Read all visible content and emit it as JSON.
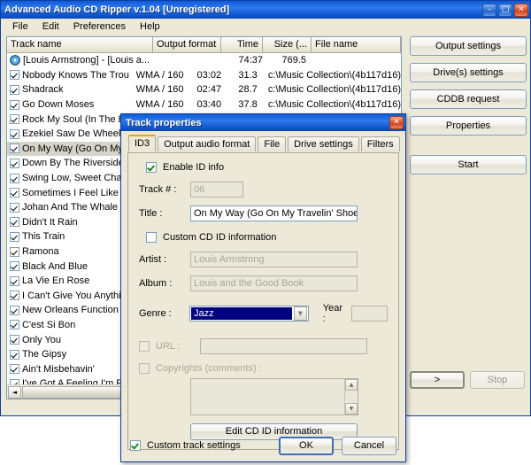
{
  "window": {
    "title": "Advanced Audio CD Ripper v.1.04 [Unregistered]",
    "minimize_label": "–",
    "maximize_label": "□",
    "close_label": "✕"
  },
  "menu": {
    "items": [
      {
        "label": "File"
      },
      {
        "label": "Edit"
      },
      {
        "label": "Preferences"
      },
      {
        "label": "Help"
      }
    ]
  },
  "list": {
    "columns": [
      {
        "label": "Track name"
      },
      {
        "label": "Output format"
      },
      {
        "label": "Time"
      },
      {
        "label": "Size (..."
      },
      {
        "label": "File name"
      }
    ],
    "rows": [
      {
        "icon": "cd-disc-icon",
        "checked": null,
        "name": "[Louis Armstrong] - [Louis a...",
        "format": "",
        "time": "74:37",
        "size": "769.5",
        "file": ""
      },
      {
        "icon": "checkbox",
        "checked": true,
        "name": "Nobody Knows The Trouble ...",
        "format": "WMA / 160",
        "time": "03:02",
        "size": "31.3",
        "file": "c:\\Music Collection\\(4b117d16)"
      },
      {
        "icon": "checkbox",
        "checked": true,
        "name": "Shadrack",
        "format": "WMA / 160",
        "time": "02:47",
        "size": "28.7",
        "file": "c:\\Music Collection\\(4b117d16)"
      },
      {
        "icon": "checkbox",
        "checked": true,
        "name": "Go Down Moses",
        "format": "WMA / 160",
        "time": "03:40",
        "size": "37.8",
        "file": "c:\\Music Collection\\(4b117d16)"
      },
      {
        "icon": "checkbox",
        "checked": true,
        "name": "Rock My Soul (In The Bosom",
        "format": "WMA / 160",
        "time": "02:58",
        "size": "30.6",
        "file": "c:\\Music Collection\\(4b117d16)"
      },
      {
        "icon": "checkbox",
        "checked": true,
        "name": "Ezekiel Saw De Wheel",
        "format": "",
        "time": "",
        "size": "",
        "file": ")"
      },
      {
        "icon": "checkbox",
        "checked": true,
        "name": "On My Way (Go On My Tr",
        "format": "",
        "time": "",
        "size": "",
        "file": ")",
        "selected": true
      },
      {
        "icon": "checkbox",
        "checked": true,
        "name": "Down By The Riverside",
        "format": "",
        "time": "",
        "size": "",
        "file": ")"
      },
      {
        "icon": "checkbox",
        "checked": true,
        "name": "Swing Low, Sweet Chario",
        "format": "",
        "time": "",
        "size": "",
        "file": ")"
      },
      {
        "icon": "checkbox",
        "checked": true,
        "name": "Sometimes I Feel Like A M",
        "format": "",
        "time": "",
        "size": "",
        "file": ")"
      },
      {
        "icon": "checkbox",
        "checked": true,
        "name": "Johan And The Whale",
        "format": "",
        "time": "",
        "size": "",
        "file": ")"
      },
      {
        "icon": "checkbox",
        "checked": true,
        "name": "Didn't It Rain",
        "format": "",
        "time": "",
        "size": "",
        "file": ")"
      },
      {
        "icon": "checkbox",
        "checked": true,
        "name": "This Train",
        "format": "",
        "time": "",
        "size": "",
        "file": ")"
      },
      {
        "icon": "checkbox",
        "checked": true,
        "name": "Ramona",
        "format": "",
        "time": "",
        "size": "",
        "file": ")"
      },
      {
        "icon": "checkbox",
        "checked": true,
        "name": "Black And Blue",
        "format": "",
        "time": "",
        "size": "",
        "file": ")"
      },
      {
        "icon": "checkbox",
        "checked": true,
        "name": "La Vie En Rose",
        "format": "",
        "time": "",
        "size": "",
        "file": ")"
      },
      {
        "icon": "checkbox",
        "checked": true,
        "name": "I Can't Give You Anything",
        "format": "",
        "time": "",
        "size": "",
        "file": ")"
      },
      {
        "icon": "checkbox",
        "checked": true,
        "name": "New Orleans Function",
        "format": "",
        "time": "",
        "size": "",
        "file": ")"
      },
      {
        "icon": "checkbox",
        "checked": true,
        "name": "C'est Si Bon",
        "format": "",
        "time": "",
        "size": "",
        "file": ")"
      },
      {
        "icon": "checkbox",
        "checked": true,
        "name": "Only You",
        "format": "",
        "time": "",
        "size": "",
        "file": ")"
      },
      {
        "icon": "checkbox",
        "checked": true,
        "name": "The Gipsy",
        "format": "",
        "time": "",
        "size": "",
        "file": ")"
      },
      {
        "icon": "checkbox",
        "checked": true,
        "name": "Ain't Misbehavin'",
        "format": "",
        "time": "",
        "size": "",
        "file": ")"
      },
      {
        "icon": "checkbox",
        "checked": true,
        "name": "I've Got A Feeling I'm Fall",
        "format": "",
        "time": "",
        "size": "",
        "file": ")"
      }
    ],
    "scrollbar": {
      "left_arrow": "◄",
      "right_arrow": "►"
    }
  },
  "side_buttons": [
    {
      "label": "Output settings"
    },
    {
      "label": "Drive(s) settings"
    },
    {
      "label": "CDDB request"
    },
    {
      "label": "Properties"
    },
    {
      "label": "Start"
    }
  ],
  "bottom_buttons": {
    "next_label": ">",
    "stop_label": "Stop"
  },
  "dialog": {
    "title": "Track properties",
    "close_label": "✕",
    "tabs": [
      {
        "label": "ID3",
        "active": true
      },
      {
        "label": "Output audio format",
        "active": false
      },
      {
        "label": "File",
        "active": false
      },
      {
        "label": "Drive settings",
        "active": false
      },
      {
        "label": "Filters",
        "active": false
      }
    ],
    "enable_id_label": "Enable ID info",
    "enable_id_checked": true,
    "track_number_label": "Track # :",
    "track_number_value": "06",
    "title_label": "Title :",
    "title_value": "On My Way (Go On My Travelin' Shoes)",
    "custom_cd_id_label": "Custom CD ID information",
    "custom_cd_id_checked": false,
    "artist_label": "Artist :",
    "artist_value": "Louis Armstrong",
    "album_label": "Album :",
    "album_value": "Louis and the Good Book",
    "genre_label": "Genre :",
    "genre_value": "Jazz",
    "genre_arrow": "▼",
    "year_label": "Year :",
    "year_value": "",
    "url_label": "URL :",
    "url_value": "",
    "copyrights_label": "Copyrights (comments) :",
    "copyrights_value": "",
    "memo_up": "▲",
    "memo_down": "▼",
    "edit_cd_id_label": "Edit CD ID information",
    "custom_track_settings_label": "Custom track settings",
    "custom_track_settings_checked": true,
    "ok_label": "OK",
    "cancel_label": "Cancel"
  }
}
